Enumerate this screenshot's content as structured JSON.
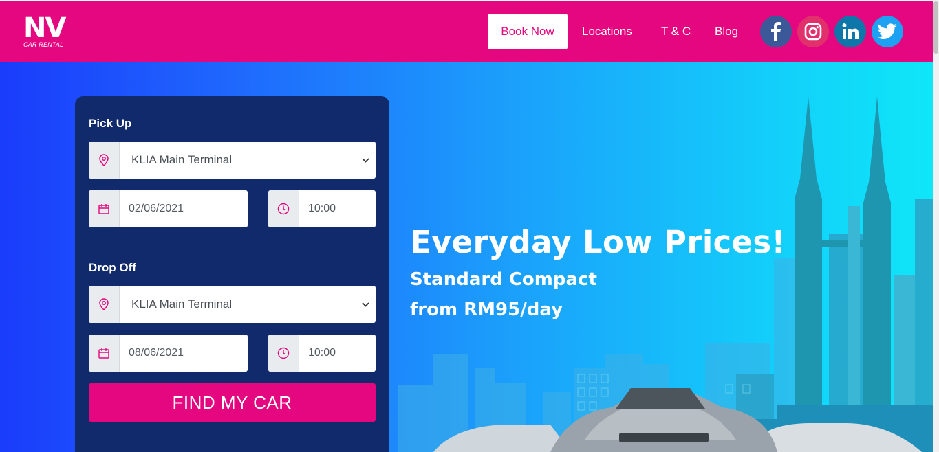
{
  "brand": {
    "logo_text": "NV",
    "logo_subtext": "CAR RENTAL"
  },
  "nav": {
    "book_now": "Book Now",
    "locations": "Locations",
    "terms": "T & C",
    "blog": "Blog"
  },
  "social": [
    {
      "icon": "facebook-icon",
      "color": "#3b5998"
    },
    {
      "icon": "instagram-icon",
      "color": "#e1306c"
    },
    {
      "icon": "linkedin-icon",
      "color": "#0e76a8"
    },
    {
      "icon": "twitter-icon",
      "color": "#1da1f2"
    }
  ],
  "booking": {
    "pickup": {
      "label": "Pick Up",
      "location": "KLIA Main Terminal",
      "date": "02/06/2021",
      "time": "10:00"
    },
    "dropoff": {
      "label": "Drop Off",
      "location": "KLIA Main Terminal",
      "date": "08/06/2021",
      "time": "10:00"
    },
    "submit_label": "FIND MY CAR"
  },
  "hero": {
    "title": "Everyday Low Prices!",
    "line1": "Standard Compact",
    "line2": "from RM95/day"
  },
  "colors": {
    "brand_pink": "#e4077f",
    "form_navy": "#112a6b",
    "hero_gradient_start": "#1a3cfb",
    "hero_gradient_end": "#0fe6f8"
  }
}
